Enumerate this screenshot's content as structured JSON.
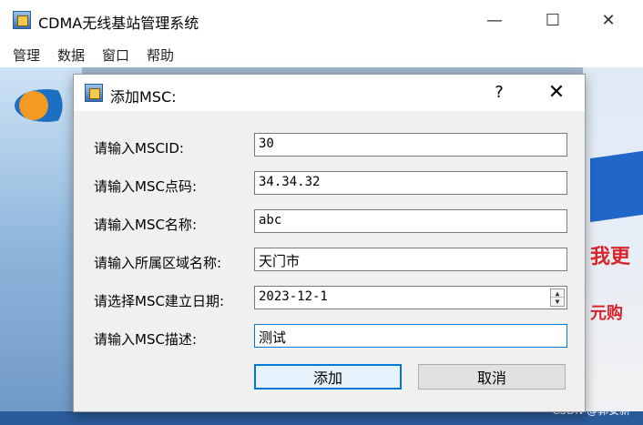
{
  "window": {
    "title": "CDMA无线基站管理系统",
    "controls": {
      "minimize": "—",
      "maximize": "☐",
      "close": "✕"
    }
  },
  "menubar": {
    "items": [
      "管理",
      "数据",
      "窗口",
      "帮助"
    ]
  },
  "background": {
    "promo_text_1": "我更",
    "promo_text_2": "元购"
  },
  "dialog": {
    "title": "添加MSC:",
    "help": "?",
    "close": "✕",
    "fields": [
      {
        "label": "请输入MSCID:",
        "value": "30"
      },
      {
        "label": "请输入MSC点码:",
        "value": "34.34.32"
      },
      {
        "label": "请输入MSC名称:",
        "value": "abc"
      },
      {
        "label": "请输入所属区域名称:",
        "value": "天门市"
      },
      {
        "label": "请选择MSC建立日期:",
        "value": "2023-12-1"
      },
      {
        "label": "请输入MSC描述:",
        "value": "测试"
      }
    ],
    "buttons": {
      "add": "添加",
      "cancel": "取消"
    }
  },
  "watermark": "CSDN @郭安新",
  "colors": {
    "accent": "#0078d7",
    "dialog_bg": "#f0f0f0",
    "promo_red": "#d8262c",
    "promo_blue": "#2167c9"
  }
}
